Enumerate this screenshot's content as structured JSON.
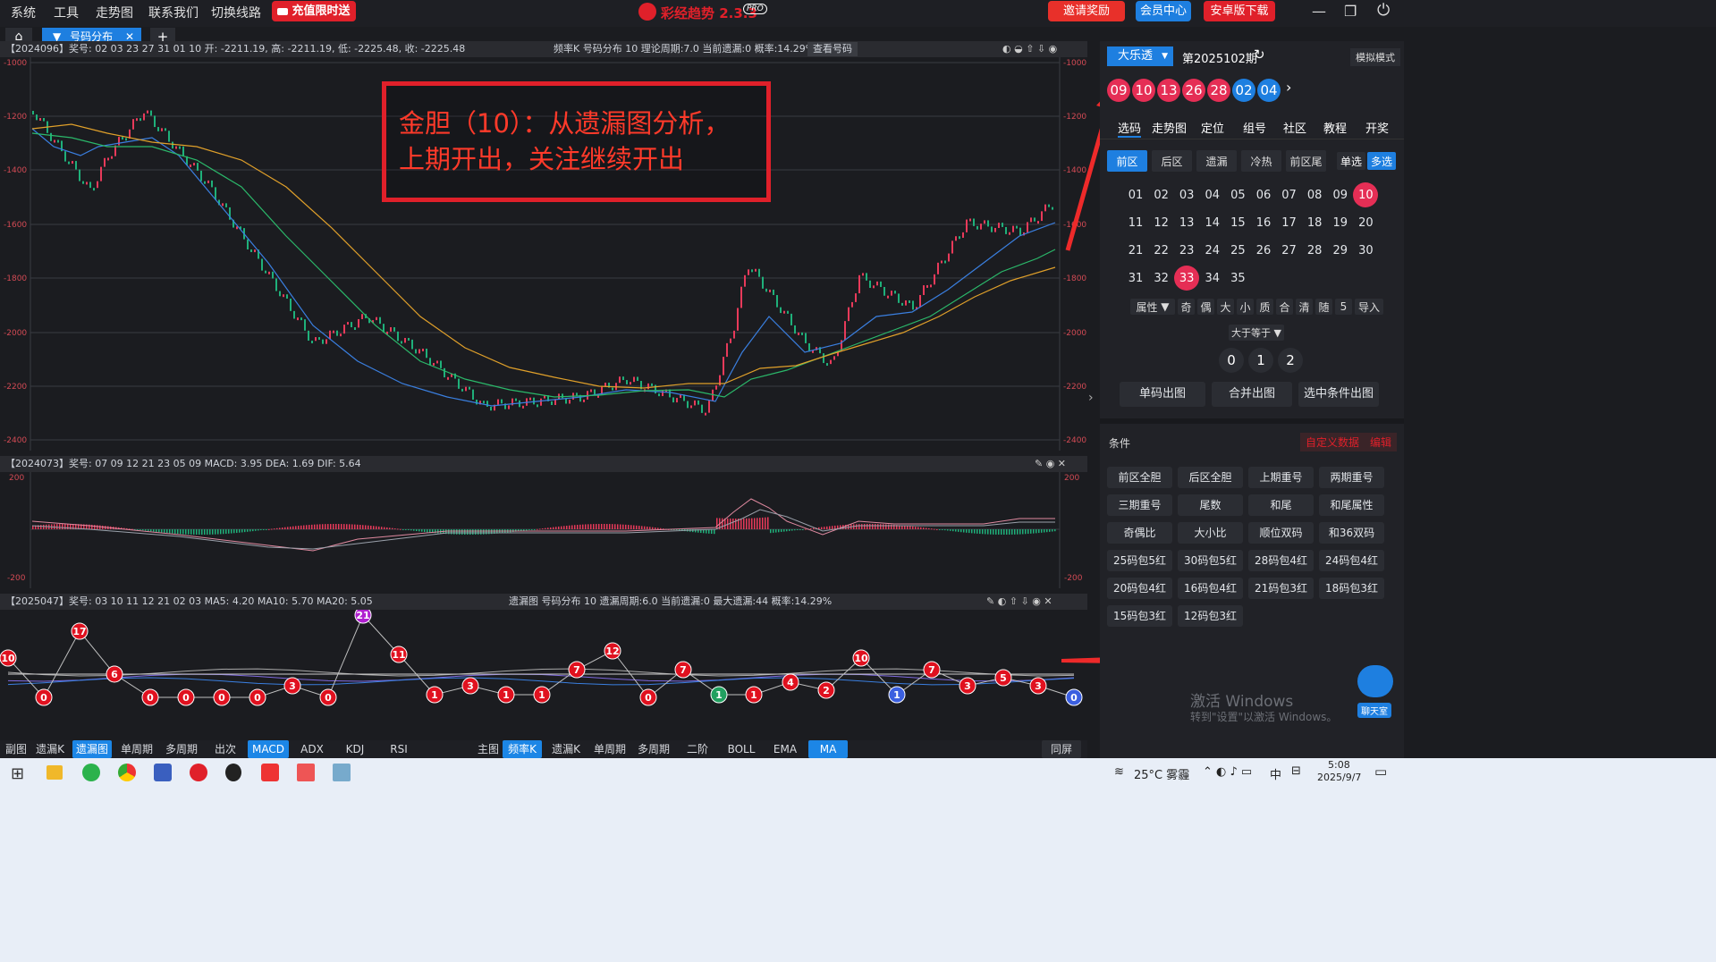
{
  "titlebar": {
    "menus": [
      "系统",
      "工具",
      "走势图",
      "联系我们",
      "切换线路"
    ],
    "recharge": "充值限时送",
    "app_title": "彩经趋势 2.3.3",
    "pro": "PRO",
    "invite": "邀请奖励",
    "member": "会员中心",
    "android": "安卓版下载"
  },
  "tabs": {
    "active": "号码分布"
  },
  "main_chart": {
    "header": "【2024096】奖号: 02 03 23 27 31 01 10 开: -2211.19, 高: -2211.19, 低: -2225.48, 收: -2225.48",
    "header_right": "频率K  号码分布 10   理论周期:7.0  当前遗漏:0  概率:14.29%",
    "check_button": "查看号码",
    "y_ticks": [
      "-1000",
      "-1200",
      "-1400",
      "-1600",
      "-1800",
      "-2000",
      "-2200",
      "-2400"
    ],
    "annotation_line1": "金胆（10）：从遗漏图分析，",
    "annotation_line2": "上期开出，关注继续开出"
  },
  "macd_panel": {
    "header": "【2024073】奖号: 07 09 12 21 23 05 09 MACD: 3.95 DEA: 1.69 DIF: 5.64",
    "ticks": [
      "200",
      "200",
      "-200",
      "-200"
    ]
  },
  "miss_panel": {
    "header": "【2025047】奖号: 03 10 11 12 21 02 03 MA5: 4.20 MA10: 5.70 MA20: 5.05",
    "header_right": "遗漏图  号码分布 10   遗漏周期:6.0  当前遗漏:0  最大遗漏:44  概率:14.29%",
    "points": [
      {
        "v": "10",
        "c": "#e0111f"
      },
      {
        "v": "0",
        "c": "#e0111f"
      },
      {
        "v": "17",
        "c": "#e0111f"
      },
      {
        "v": "6",
        "c": "#e0111f"
      },
      {
        "v": "0",
        "c": "#e0111f"
      },
      {
        "v": "0",
        "c": "#e0111f"
      },
      {
        "v": "0",
        "c": "#e0111f"
      },
      {
        "v": "0",
        "c": "#e0111f"
      },
      {
        "v": "3",
        "c": "#e0111f"
      },
      {
        "v": "0",
        "c": "#e0111f"
      },
      {
        "v": "21",
        "c": "#b01fd0"
      },
      {
        "v": "11",
        "c": "#e0111f"
      },
      {
        "v": "1",
        "c": "#e0111f"
      },
      {
        "v": "3",
        "c": "#e0111f"
      },
      {
        "v": "1",
        "c": "#e0111f"
      },
      {
        "v": "1",
        "c": "#e0111f"
      },
      {
        "v": "7",
        "c": "#e0111f"
      },
      {
        "v": "12",
        "c": "#e0111f"
      },
      {
        "v": "0",
        "c": "#e0111f"
      },
      {
        "v": "7",
        "c": "#e0111f"
      },
      {
        "v": "1",
        "c": "#21a060"
      },
      {
        "v": "1",
        "c": "#e0111f"
      },
      {
        "v": "4",
        "c": "#e0111f"
      },
      {
        "v": "2",
        "c": "#e0111f"
      },
      {
        "v": "10",
        "c": "#e0111f"
      },
      {
        "v": "1",
        "c": "#3b5fe0"
      },
      {
        "v": "7",
        "c": "#e0111f"
      },
      {
        "v": "3",
        "c": "#e0111f"
      },
      {
        "v": "5",
        "c": "#e0111f"
      },
      {
        "v": "3",
        "c": "#e0111f"
      },
      {
        "v": "0",
        "c": "#3b5fe0"
      }
    ]
  },
  "bottom_toolbar": {
    "left_label": "副图",
    "left": [
      "遗漏K",
      "遗漏图",
      "单周期",
      "多周期",
      "出次",
      "MACD",
      "ADX",
      "KDJ",
      "RSI"
    ],
    "main_label": "主图",
    "main": [
      "频率K",
      "遗漏K",
      "单周期",
      "多周期",
      "二阶",
      "BOLL",
      "EMA",
      "MA"
    ],
    "same": "同屏"
  },
  "right_panel": {
    "lottery": "大乐透",
    "issue": "第2025102期",
    "simulate": "模拟模式",
    "balls": [
      "09",
      "10",
      "13",
      "26",
      "28",
      "02",
      "04"
    ],
    "nav": [
      "选码",
      "走势图",
      "定位",
      "组号",
      "社区",
      "教程",
      "开奖"
    ],
    "zones": [
      "前区",
      "后区",
      "遗漏",
      "冷热",
      "前区尾"
    ],
    "single": "单选",
    "multi": "多选",
    "numbers": [
      "01",
      "02",
      "03",
      "04",
      "05",
      "06",
      "07",
      "08",
      "09",
      "10",
      "11",
      "12",
      "13",
      "14",
      "15",
      "16",
      "17",
      "18",
      "19",
      "20",
      "21",
      "22",
      "23",
      "24",
      "25",
      "26",
      "27",
      "28",
      "29",
      "30",
      "31",
      "32",
      "33",
      "34",
      "35"
    ],
    "selected": [
      "10",
      "33"
    ],
    "attr": "属性",
    "attr_btns": [
      "奇",
      "偶",
      "大",
      "小",
      "质",
      "合",
      "清"
    ],
    "random_label": "随",
    "random_value": "5",
    "import": "导入",
    "compare": "大于等于",
    "counts": [
      "0",
      "1",
      "2"
    ],
    "out_buttons": [
      "单码出图",
      "合并出图",
      "选中条件出图"
    ],
    "conditions_label": "条件",
    "custom": "自定义数据",
    "edit": "编辑",
    "conditions": [
      "前区全胆",
      "后区全胆",
      "上期重号",
      "两期重号",
      "三期重号",
      "尾数",
      "和尾",
      "和尾属性",
      "奇偶比",
      "大小比",
      "顺位双码",
      "和36双码",
      "25码包5红",
      "30码包5红",
      "28码包4红",
      "24码包4红",
      "20码包4红",
      "16码包4红",
      "21码包3红",
      "18码包3红",
      "15码包3红",
      "12码包3红"
    ],
    "win_activate": "激活 Windows",
    "win_sub": "转到\"设置\"以激活 Windows。",
    "chat": "聊天室"
  },
  "taskbar": {
    "weather": "25°C 雾霾",
    "ime": "中",
    "time": "5:08",
    "date": "2025/9/7"
  }
}
